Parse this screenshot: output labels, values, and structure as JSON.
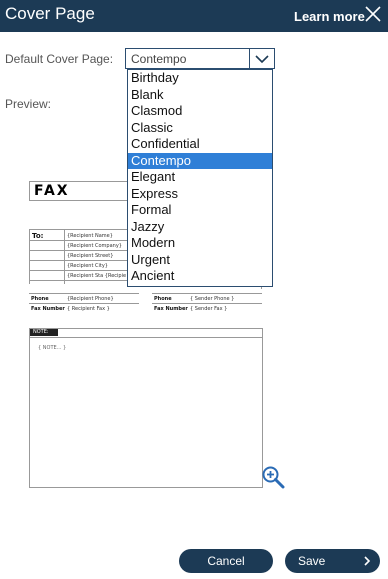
{
  "header": {
    "title": "Cover Page",
    "learn_more": "Learn more",
    "close_icon": "close-icon"
  },
  "form": {
    "default_label": "Default Cover Page:",
    "selected_value": "Contempo",
    "preview_label": "Preview:"
  },
  "dropdown": {
    "options": [
      "Birthday",
      "Blank",
      "Clasmod",
      "Classic",
      "Confidential",
      "Contempo",
      "Elegant",
      "Express",
      "Formal",
      "Jazzy",
      "Modern",
      "Urgent",
      "Ancient"
    ],
    "selected_index": 5
  },
  "preview": {
    "fax_title": "FAX",
    "to_label": "To:",
    "recipient_fields": [
      "{Recipient Name}",
      "{Recipient Company}",
      "{Recipient Street}",
      "{Recipient City}",
      "{Recipient Sta {Recipie"
    ],
    "phone_label": "Phone",
    "fax_number_label": "Fax Number",
    "recipient_phone": "{Recipient Phone}",
    "recipient_fax": "{ Recipient Fax }",
    "sender_phone": "{ Sender Phone }",
    "sender_fax": "{ Sender Fax }",
    "note_label": "NOTE:",
    "note_text": "{ NOTE... }"
  },
  "buttons": {
    "cancel": "Cancel",
    "save": "Save"
  },
  "colors": {
    "header_bg": "#1c3a55",
    "button_bg": "#1c3a55",
    "selection": "#2f7fd7"
  }
}
